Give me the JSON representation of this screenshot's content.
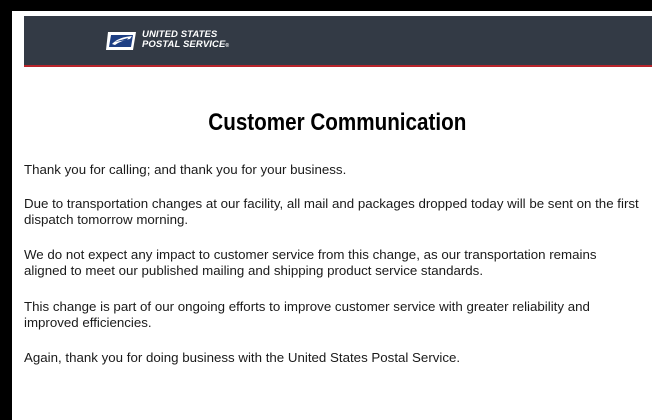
{
  "header": {
    "logo_line1": "UNITED STATES",
    "logo_line2": "POSTAL SERVICE",
    "logo_reg": "®",
    "banner_color": "#333a45",
    "accent_color": "#b8242b",
    "logo_icon": "usps-eagle-icon"
  },
  "document": {
    "title": "Customer Communication",
    "paragraphs": [
      "Thank you for calling; and thank you for your business.",
      "Due to transportation changes at our facility, all mail and packages dropped today will be sent on the first dispatch tomorrow morning.",
      "We do not expect any impact to customer service from this change, as our transportation remains aligned to meet our published mailing and shipping product service standards.",
      "This change is part of our ongoing efforts to improve customer service with greater reliability and improved efficiencies.",
      "Again, thank you for doing business with the United States Postal Service."
    ]
  }
}
